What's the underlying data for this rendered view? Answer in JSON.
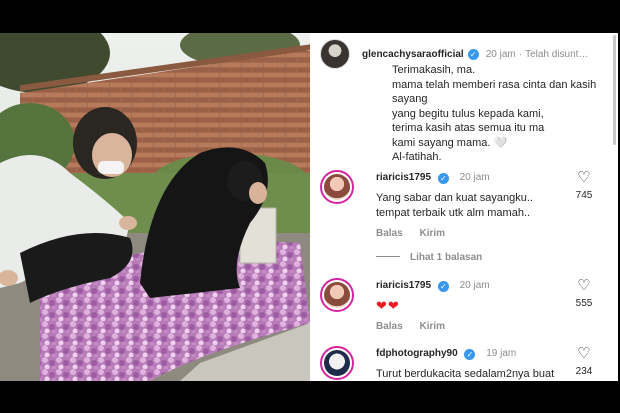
{
  "post": {
    "author": "glencachysaraofficial",
    "time": "20 jam",
    "edited": "Telah disunt…",
    "caption_lines": [
      "Terimakasih, ma.",
      "mama telah memberi rasa cinta dan kasih sayang",
      "yang begitu tulus kepada kami,",
      "terima kasih atas semua itu ma",
      "kami sayang mama. 🤍",
      "Al-fatihah."
    ]
  },
  "comments": [
    {
      "user": "riaricis1795",
      "time": "20 jam",
      "text_lines": [
        "Yang sabar dan kuat sayangku..",
        "tempat terbaik utk alm mamah.."
      ],
      "reply": "Balas",
      "send": "Kirim",
      "likes": "745",
      "replies_link": "Lihat 1 balasan"
    },
    {
      "user": "riaricis1795",
      "time": "20 jam",
      "text_lines": [
        "❤❤"
      ],
      "reply": "Balas",
      "send": "Kirim",
      "likes": "555"
    },
    {
      "user": "fdphotography90",
      "time": "19 jam",
      "text_lines": [
        "Turut berdukacita sedalam2nya buat"
      ],
      "likes": "234"
    }
  ],
  "icons": {
    "verified": "verified-badge-icon",
    "like": "heart-outline-icon"
  },
  "colors": {
    "verified": "#3897f0",
    "story_ring": "#d6249f",
    "flower_petals": "#c98bc9"
  }
}
